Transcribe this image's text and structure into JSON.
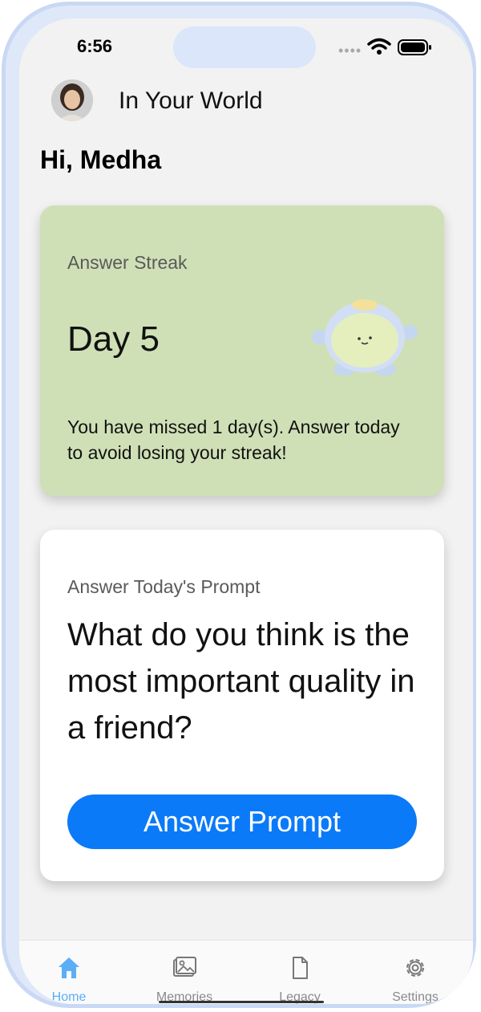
{
  "status_bar": {
    "time": "6:56"
  },
  "header": {
    "app_title": "In Your World"
  },
  "greeting": "Hi, Medha",
  "streak_card": {
    "label": "Answer Streak",
    "day": "Day 5",
    "message": "You have missed 1 day(s). Answer today to avoid losing your streak!"
  },
  "prompt_card": {
    "label": "Answer Today's Prompt",
    "question": "What do you think is the most important quality in a friend?",
    "button_label": "Answer Prompt"
  },
  "tabs": [
    {
      "label": "Home",
      "icon": "home-icon",
      "active": true
    },
    {
      "label": "Memories",
      "icon": "photo-icon"
    },
    {
      "label": "Legacy",
      "icon": "document-icon"
    },
    {
      "label": "Settings",
      "icon": "gear-icon"
    }
  ],
  "colors": {
    "streak_card_bg": "#cfe0b6",
    "accent_button": "#0a7af8",
    "active_tab": "#5aaef6"
  }
}
